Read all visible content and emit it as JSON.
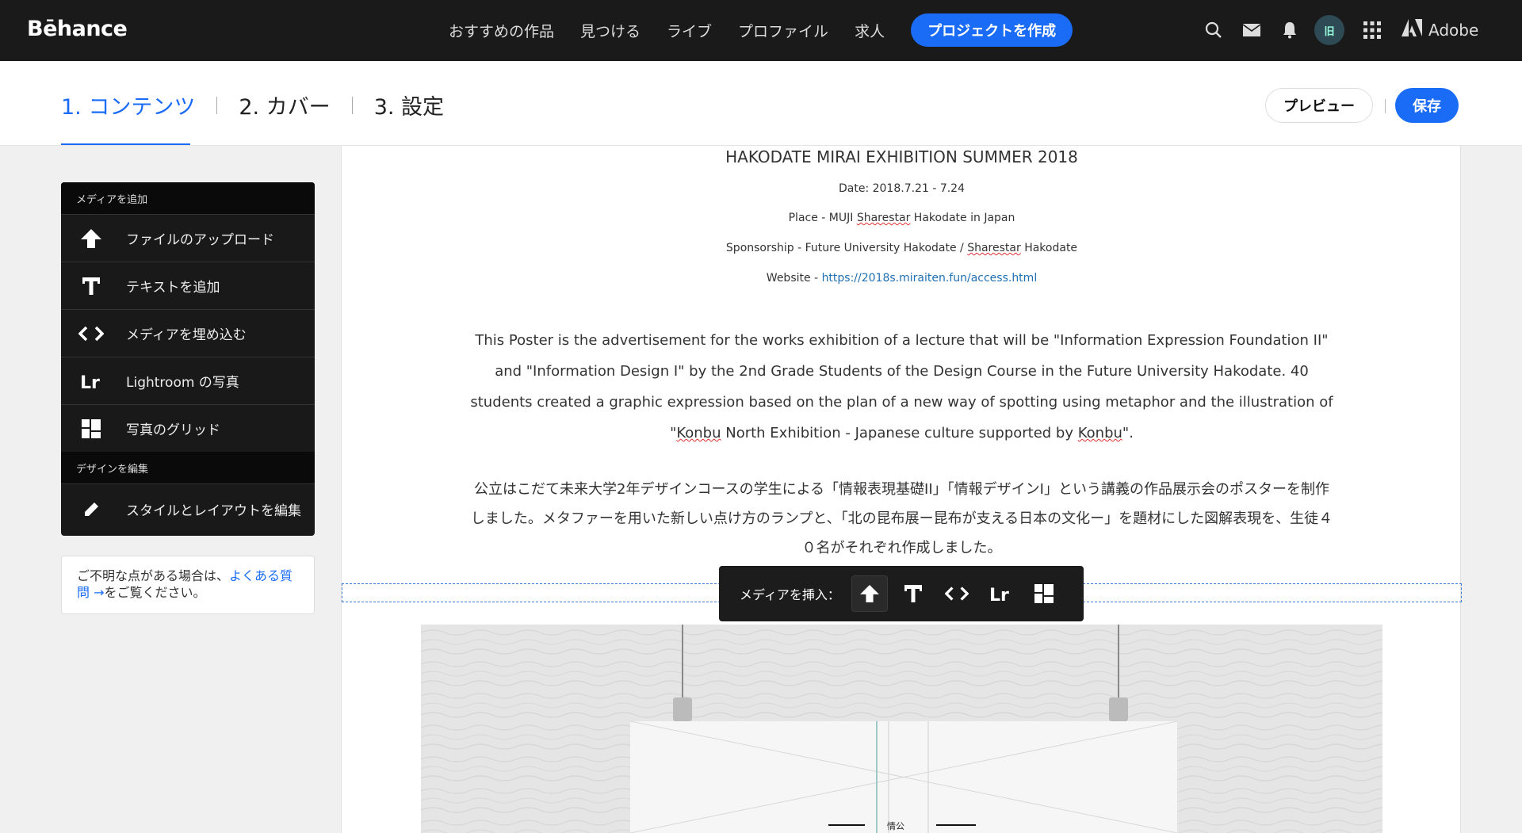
{
  "brand": {
    "name": "Bēhance"
  },
  "nav": {
    "links": [
      "おすすめの作品",
      "見つける",
      "ライブ",
      "プロファイル",
      "求人"
    ],
    "create_label": "プロジェクトを作成",
    "icons": [
      "search-icon",
      "mail-icon",
      "bell-icon",
      "avatar",
      "apps-grid-icon"
    ],
    "avatar_initials": "旧",
    "adobe_label": "Adobe"
  },
  "steps": {
    "items": [
      "1. コンテンツ",
      "2. カバー",
      "3. 設定"
    ],
    "active_index": 0
  },
  "header_actions": {
    "preview_label": "プレビュー",
    "save_label": "保存"
  },
  "panel": {
    "section_media": "メディアを追加",
    "items": [
      {
        "icon": "upload-arrow-icon",
        "label": "ファイルのアップロード"
      },
      {
        "icon": "text-t-icon",
        "label": "テキストを追加"
      },
      {
        "icon": "embed-code-icon",
        "label": "メディアを埋め込む"
      },
      {
        "icon": "lightroom-icon",
        "label": "Lightroom の写真"
      },
      {
        "icon": "photo-grid-icon",
        "label": "写真のグリッド"
      }
    ],
    "section_design": "デザインを編集",
    "design_item": {
      "icon": "pencil-icon",
      "label": "スタイルとレイアウトを編集"
    }
  },
  "help": {
    "prefix": "ご不明な点がある場合は、",
    "link": "よくある質問 →",
    "suffix": "をご覧ください。"
  },
  "content": {
    "title": "HAKODATE MIRAI EXHIBITION SUMMER 2018",
    "date": "Date: 2018.7.21 - 7.24",
    "place": "Place  -  MUJI Sharestar Hakodate in Japan",
    "sponsorship": "Sponsorship  -  Future University Hakodate / Sharestar Hakodate",
    "website_label": "Website  -  ",
    "website_url": "https://2018s.miraiten.fun/access.html",
    "paragraph_en": "This Poster is the advertisement for the works exhibition of a lecture that will be \"Information Expression Foundation II\" and \"Information Design I\" by the 2nd Grade Students of the Design Course in the Future University Hakodate. 40 students created a graphic expression based on the plan of a new way of spotting using metaphor and the illustration of \"Konbu North Exhibition - Japanese culture supported by Konbu\".",
    "paragraph_jp": "公立はこだて未来大学2年デザインコースの学生による「情報表現基礎II」「情報デザインI」という講義の作品展示会のポスターを制作しました。メタファーを用いた新しい点け方のランプと、「北の昆布展ー昆布が支える日本の文化ー」を題材にした図解表現を、生徒４０名がそれぞれ作成しました。",
    "poster_text": "情公"
  },
  "insert_bar": {
    "label": "メディアを挿入：",
    "icons": [
      "upload-arrow-icon",
      "text-t-icon",
      "embed-code-icon",
      "lightroom-icon",
      "photo-grid-icon"
    ]
  }
}
